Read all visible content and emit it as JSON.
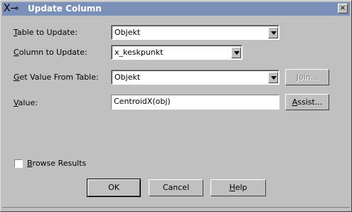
{
  "window": {
    "title": "Update Column",
    "close_label": "×"
  },
  "form": {
    "table_label_first": "T",
    "table_label_rest": "able to Update:",
    "table_value": "Objekt",
    "column_label_first": "C",
    "column_label_rest": "olumn to Update:",
    "column_value": "x_keskpunkt",
    "get_label_first": "G",
    "get_label_rest": "et Value From Table:",
    "get_value": "Objekt",
    "join_label": "Join...",
    "value_label_first": "V",
    "value_label_rest": "alue:",
    "value_text": "CentroidX(obj)",
    "assist_label_first": "A",
    "assist_label_rest": "ssist...",
    "browse_label_first": "B",
    "browse_label_rest": "rowse Results",
    "browse_checked": false
  },
  "buttons": {
    "ok": "OK",
    "cancel": "Cancel",
    "help_first": "H",
    "help_rest": "elp"
  }
}
